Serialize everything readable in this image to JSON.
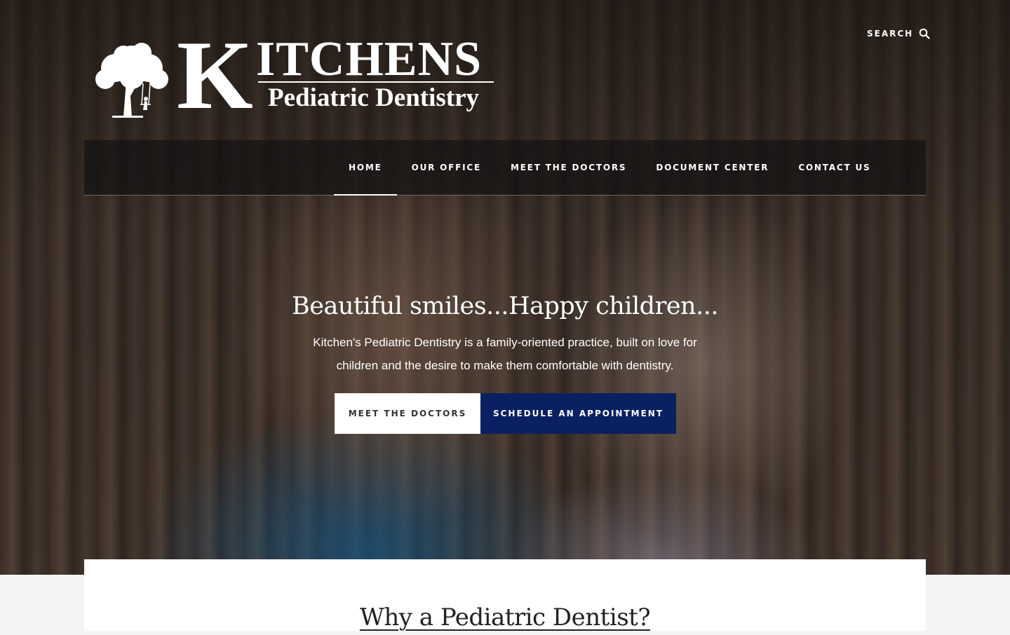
{
  "header": {
    "logo": {
      "initial": "K",
      "title_rest": "ITCHENS",
      "subtitle": "Pediatric Dentistry",
      "tree_icon": "tree-with-swing-icon"
    },
    "search": {
      "label": "SEARCH",
      "icon": "search-icon"
    }
  },
  "nav": {
    "items": [
      {
        "label": "HOME",
        "active": true
      },
      {
        "label": "OUR OFFICE",
        "active": false
      },
      {
        "label": "MEET THE DOCTORS",
        "active": false
      },
      {
        "label": "DOCUMENT CENTER",
        "active": false
      },
      {
        "label": "CONTACT US",
        "active": false
      }
    ]
  },
  "hero": {
    "headline": "Beautiful smiles...Happy children...",
    "text": "Kitchen's Pediatric Dentistry is a family-oriented practice, built on love for children and the desire to make them comfortable with dentistry.",
    "buttons": {
      "primary": "MEET THE DOCTORS",
      "secondary": "SCHEDULE AN APPOINTMENT"
    }
  },
  "section": {
    "title": "Why a Pediatric Dentist?"
  },
  "colors": {
    "accent": "#0a2060",
    "white": "#ffffff",
    "text": "#222222"
  }
}
